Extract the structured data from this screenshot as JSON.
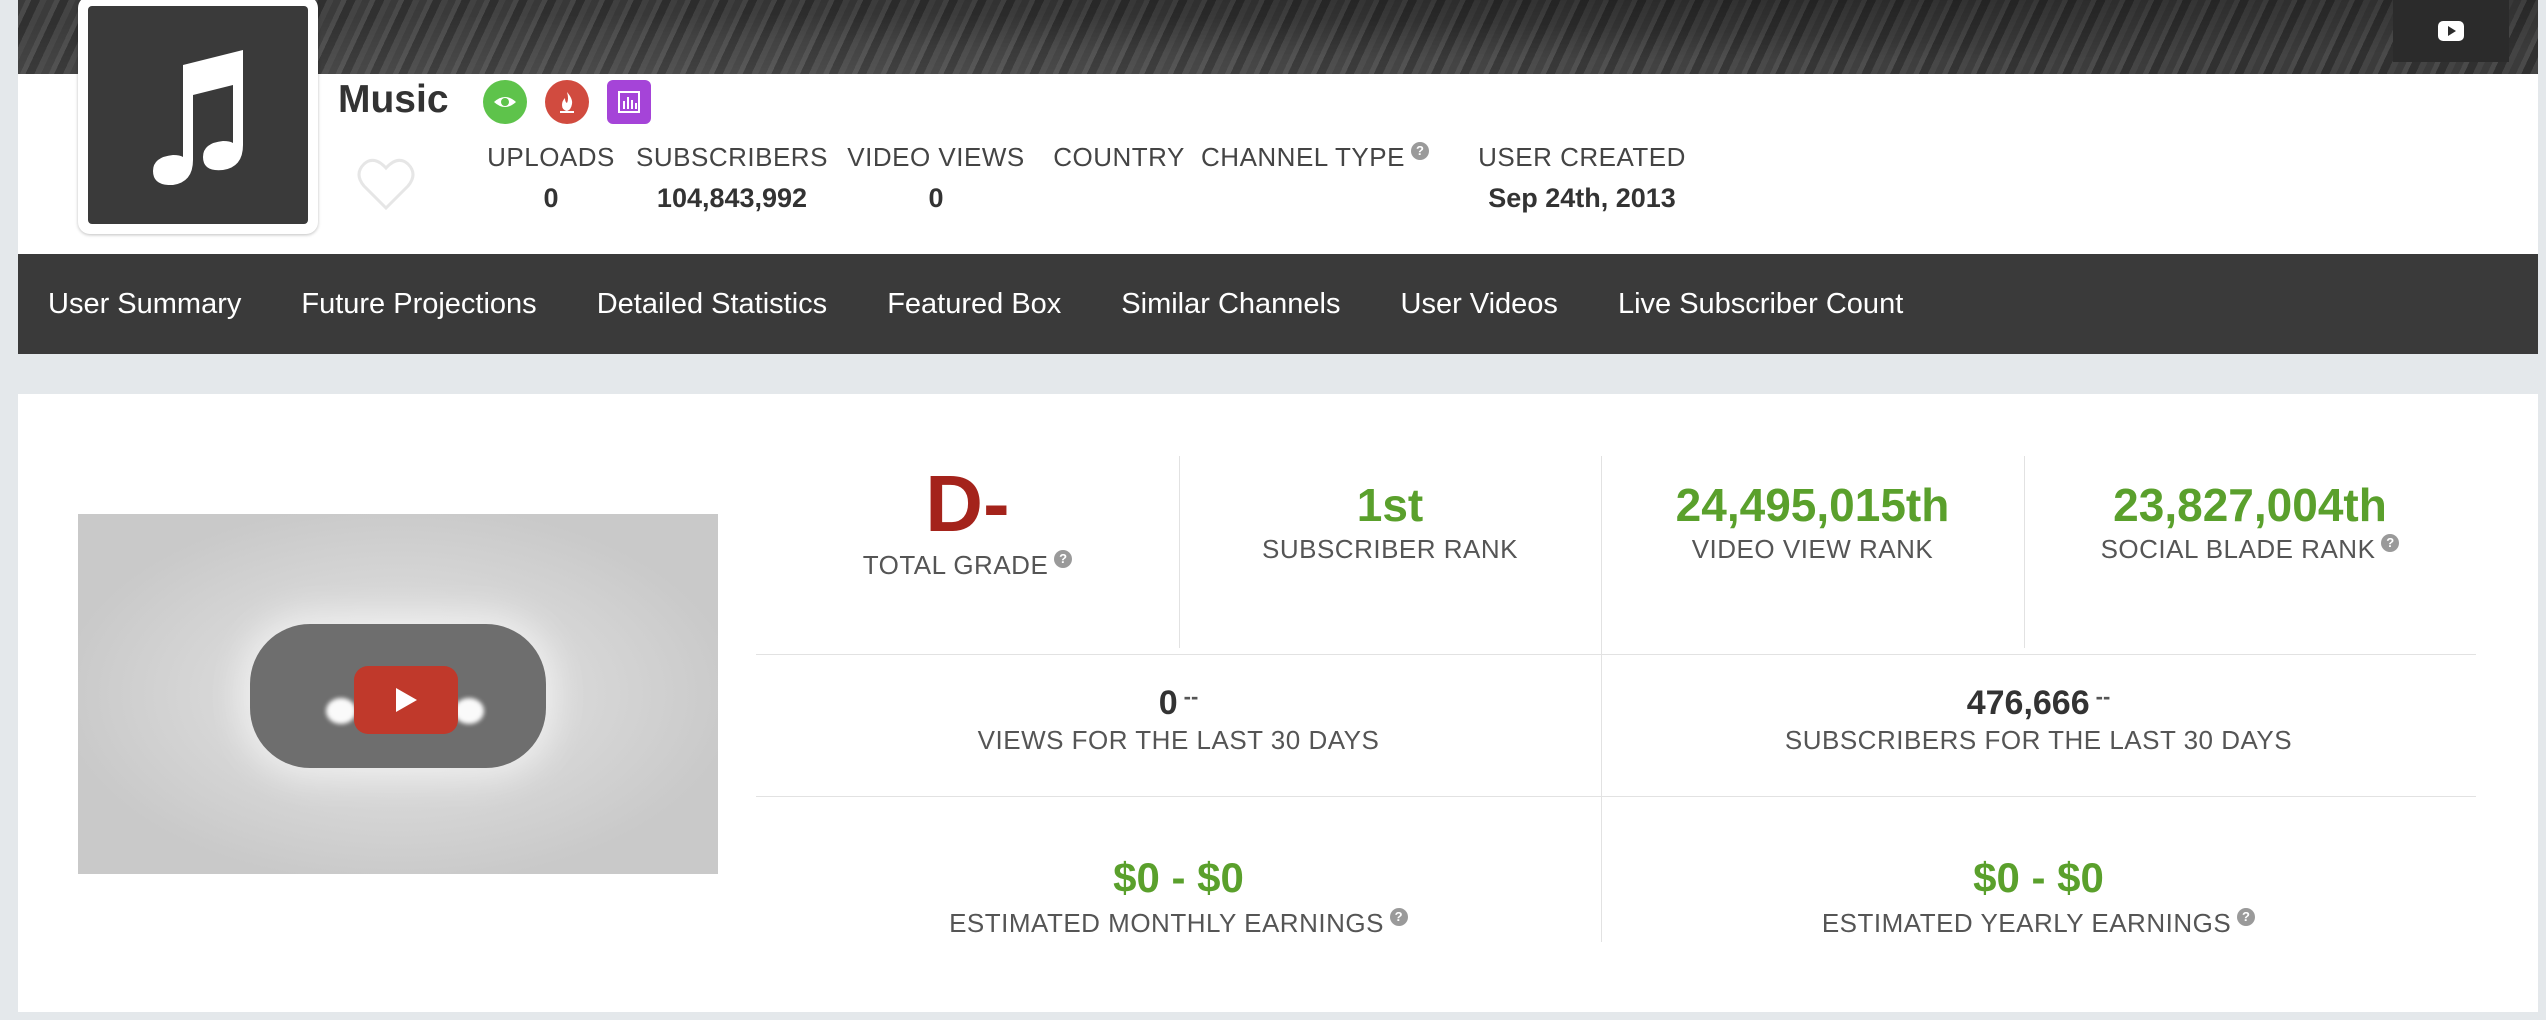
{
  "channel": {
    "name": "Music",
    "avatar_icon": "music-note-icon",
    "badges": [
      {
        "name": "eye-icon",
        "color": "#5ec34b"
      },
      {
        "name": "flame-icon",
        "color": "#d14b3f"
      },
      {
        "name": "bar-chart-icon",
        "color": "#a544d8"
      }
    ]
  },
  "header_stats": {
    "uploads": {
      "label": "UPLOADS",
      "value": "0"
    },
    "subscribers": {
      "label": "SUBSCRIBERS",
      "value": "104,843,992"
    },
    "video_views": {
      "label": "VIDEO VIEWS",
      "value": "0"
    },
    "country": {
      "label": "COUNTRY",
      "value": ""
    },
    "channel_type": {
      "label": "CHANNEL TYPE",
      "value": ""
    },
    "user_created": {
      "label": "USER CREATED",
      "value": "Sep 24th, 2013"
    }
  },
  "nav": {
    "items": [
      "User Summary",
      "Future Projections",
      "Detailed Statistics",
      "Featured Box",
      "Similar Channels",
      "User Videos",
      "Live Subscriber Count"
    ]
  },
  "summary": {
    "grade": {
      "value": "D-",
      "label": "TOTAL GRADE"
    },
    "subscriber_rank": {
      "value": "1st",
      "label": "SUBSCRIBER RANK"
    },
    "video_view_rank": {
      "value": "24,495,015th",
      "label": "VIDEO VIEW RANK"
    },
    "social_blade_rank": {
      "value": "23,827,004th",
      "label": "SOCIAL BLADE RANK"
    },
    "views_30": {
      "value": "0",
      "trend": "--",
      "label": "VIEWS FOR THE LAST 30 DAYS"
    },
    "subs_30": {
      "value": "476,666",
      "trend": "--",
      "label": "SUBSCRIBERS FOR THE LAST 30 DAYS"
    },
    "monthly": {
      "value": "$0 - $0",
      "label": "ESTIMATED MONTHLY EARNINGS"
    },
    "yearly": {
      "value": "$0 - $0",
      "label": "ESTIMATED YEARLY EARNINGS"
    }
  },
  "help_glyph": "?",
  "colors": {
    "accent_green": "#5aa02c",
    "grade_red": "#a4231b",
    "nav_bg": "#3a3a3a",
    "play_red": "#c0392b"
  }
}
